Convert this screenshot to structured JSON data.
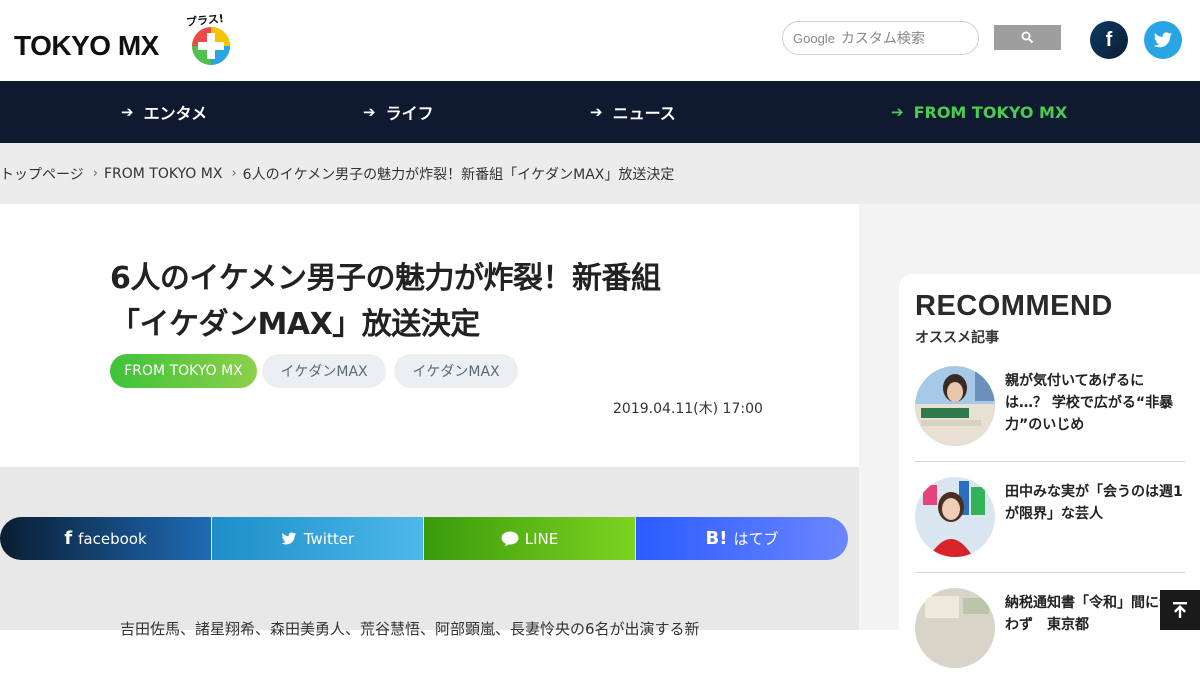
{
  "header": {
    "logo_text": "TOKYO MX",
    "logo_sub": "プラス!",
    "search_prefix": "Google",
    "search_placeholder": "カスタム検索"
  },
  "nav": {
    "items": [
      {
        "label": "エンタメ"
      },
      {
        "label": "ライフ"
      },
      {
        "label": "ニュース"
      },
      {
        "label": "FROM TOKYO MX"
      }
    ],
    "active_color": "#4ccb52"
  },
  "breadcrumb": [
    "トップページ",
    "FROM TOKYO MX",
    "6人のイケメン男子の魅力が炸裂！新番組「イケダンMAX」放送決定"
  ],
  "article": {
    "title_line1": "6人のイケメン男子の魅力が炸裂！新番組",
    "title_line2": "「イケダンMAX」放送決定",
    "tags": [
      "FROM TOKYO MX",
      "イケダンMAX",
      "イケダンMAX"
    ],
    "date": "2019.04.11(木) 17:00",
    "body_preview": "吉田佐馬、諸星翔希、森田美勇人、荒谷慧悟、阿部顕嵐、長妻怜央の6名が出演する新"
  },
  "share": {
    "facebook": "facebook",
    "twitter": "Twitter",
    "line": "LINE",
    "hatena_icon": "B!",
    "hatena": "はてブ"
  },
  "recommend": {
    "title": "RECOMMEND",
    "subtitle": "オススメ記事",
    "items": [
      {
        "line1": "親が気付いてあげるに",
        "line2": "は…？ 学校で広がる“非暴",
        "line3": "力”のいじめ"
      },
      {
        "line1": "田中みな実が「会うのは週1",
        "line2": "が限界」な芸人",
        "line3": ""
      },
      {
        "line1": "納税通知書「令和」間に合",
        "line2": "わず　東京都",
        "line3": ""
      }
    ]
  },
  "colors": {
    "nav_bg": "#0f1a30",
    "accent_green": "#4ccb52"
  }
}
